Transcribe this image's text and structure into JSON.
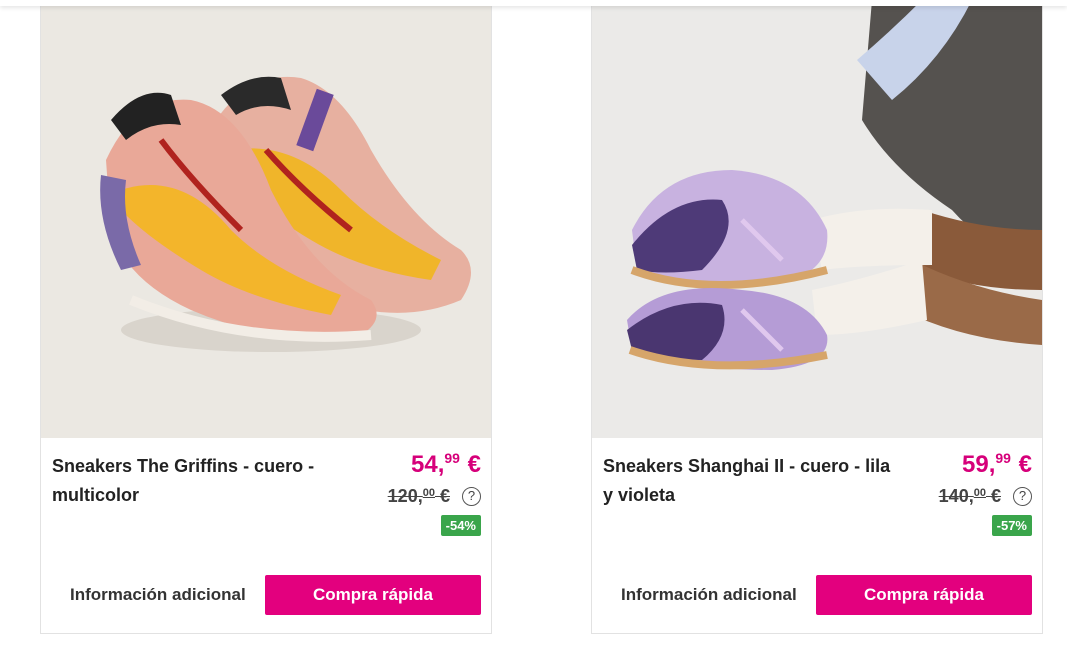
{
  "colors": {
    "accent": "#e3007e",
    "price": "#d6007a",
    "discount": "#3aa54b"
  },
  "products": [
    {
      "title": "Sneakers The Griffins - cuero - multicolor",
      "price_int": "54,",
      "price_dec": "99",
      "currency": "€",
      "old_price_int": "120,",
      "old_price_dec": "00",
      "old_currency": "€",
      "help_icon": "?",
      "discount": "-54%",
      "info_label": "Información adicional",
      "buy_label": "Compra rápida",
      "image_icon": "sneakers-multicolor-image"
    },
    {
      "title": "Sneakers Shanghai II - cuero - lila y violeta",
      "price_int": "59,",
      "price_dec": "99",
      "currency": "€",
      "old_price_int": "140,",
      "old_price_dec": "00",
      "old_currency": "€",
      "help_icon": "?",
      "discount": "-57%",
      "info_label": "Información adicional",
      "buy_label": "Compra rápida",
      "image_icon": "sneakers-lilac-image"
    }
  ]
}
